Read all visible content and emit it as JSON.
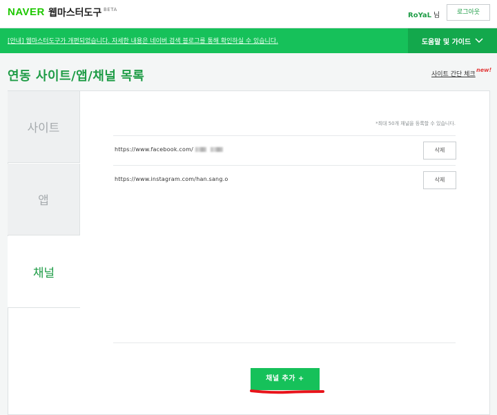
{
  "header": {
    "logo_brand": "NAVER",
    "logo_title": "웹마스터도구",
    "logo_badge": "BETA",
    "user_name": "RoYaL",
    "user_suffix": "님",
    "logout_label": "로그아웃"
  },
  "notice": {
    "text": "[안내] 웹마스터도구가 개편되었습니다. 자세한 내용은 네이버 검색 블로그를 통해 확인하실 수 있습니다.",
    "guide_label": "도움말 및 가이드"
  },
  "page": {
    "title": "연동 사이트/앱/채널 목록",
    "site_check_label": "사이트 간단 체크",
    "new_badge": "new!"
  },
  "tabs": [
    {
      "label": "사이트",
      "active": false
    },
    {
      "label": "앱",
      "active": false
    },
    {
      "label": "채널",
      "active": true
    }
  ],
  "channels": {
    "help_text": "*최대 50개 채널을 등록할 수 있습니다.",
    "items": [
      {
        "url": "https://www.facebook.com/",
        "delete_label": "삭제"
      },
      {
        "url": "https://www.instagram.com/han.sang.o",
        "delete_label": "삭제"
      }
    ],
    "add_label": "채널 추가 +"
  },
  "colors": {
    "brand_green": "#16c15a",
    "text_green": "#1e9c46",
    "guide_green": "#13a84c",
    "annotation_red": "#e8141b"
  }
}
